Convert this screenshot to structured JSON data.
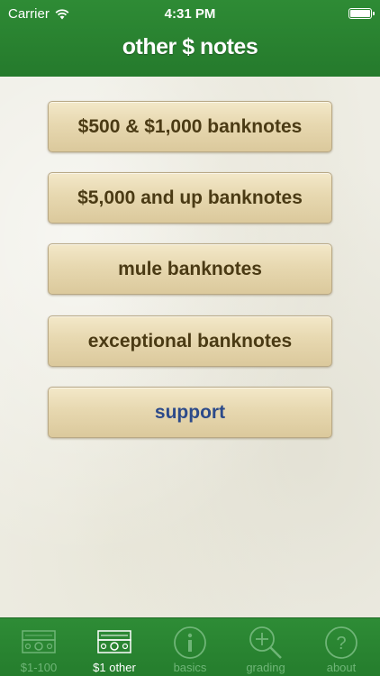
{
  "status_bar": {
    "carrier": "Carrier",
    "time": "4:31 PM",
    "battery_level": 1.0
  },
  "nav": {
    "title": "other $ notes"
  },
  "menu": {
    "items": [
      {
        "label": "$500 & $1,000 banknotes"
      },
      {
        "label": "$5,000 and up banknotes"
      },
      {
        "label": "mule banknotes"
      },
      {
        "label": "exceptional banknotes"
      },
      {
        "label": "support"
      }
    ]
  },
  "tabbar": {
    "tabs": [
      {
        "label": "$1-100",
        "icon": "banknote-icon",
        "active": false
      },
      {
        "label": "$1 other",
        "icon": "banknote-icon",
        "active": true
      },
      {
        "label": "basics",
        "icon": "info-icon",
        "active": false
      },
      {
        "label": "grading",
        "icon": "magnifier-icon",
        "active": false
      },
      {
        "label": "about",
        "icon": "question-icon",
        "active": false
      }
    ]
  },
  "colors": {
    "header_green": "#2e8b35",
    "button_text": "#4a3a14",
    "support_text": "#2c4a8a",
    "tab_inactive": "#6fb577",
    "tab_active": "#ffffff"
  }
}
